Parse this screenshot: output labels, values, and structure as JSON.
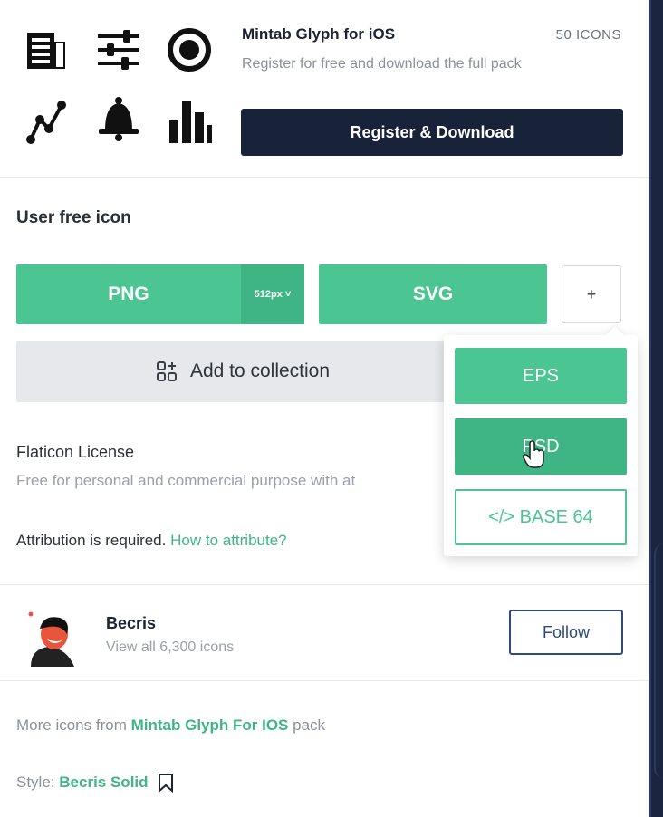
{
  "pack": {
    "title": "Mintab Glyph for iOS",
    "count": "50 ICONS",
    "subtitle": "Register for free and download the full pack",
    "register_label": "Register & Download"
  },
  "download": {
    "section_title": "User free icon",
    "png_label": "PNG",
    "png_size": "512px ˅",
    "svg_label": "SVG",
    "plus_label": "+",
    "collection_label": "Add to collection"
  },
  "formats_menu": {
    "items": [
      "EPS",
      "PSD",
      "</> BASE 64"
    ]
  },
  "license": {
    "title": "Flaticon License",
    "description": "Free for personal and commercial purpose with at",
    "attribution_text": "Attribution is required.",
    "attribution_link": "How to attribute?"
  },
  "author": {
    "name": "Becris",
    "subtitle": "View all 6,300 icons",
    "follow_label": "Follow"
  },
  "footer": {
    "more_prefix": "More icons from",
    "more_link": "Mintab Glyph For IOS",
    "more_suffix": "pack",
    "style_prefix": "Style:",
    "style_link": "Becris Solid"
  },
  "colors": {
    "green": "#4bc693",
    "green_dark": "#3fb585",
    "navy": "#182238",
    "follow_blue": "#2e4a7e"
  },
  "icons": {
    "pack": [
      "newspaper-icon",
      "sliders-icon",
      "radio-icon",
      "line-chart-icon",
      "bell-icon",
      "bar-chart-icon"
    ],
    "collection": "add-collection-icon",
    "bookmark": "bookmark-icon",
    "cursor": "hand-cursor-icon"
  }
}
